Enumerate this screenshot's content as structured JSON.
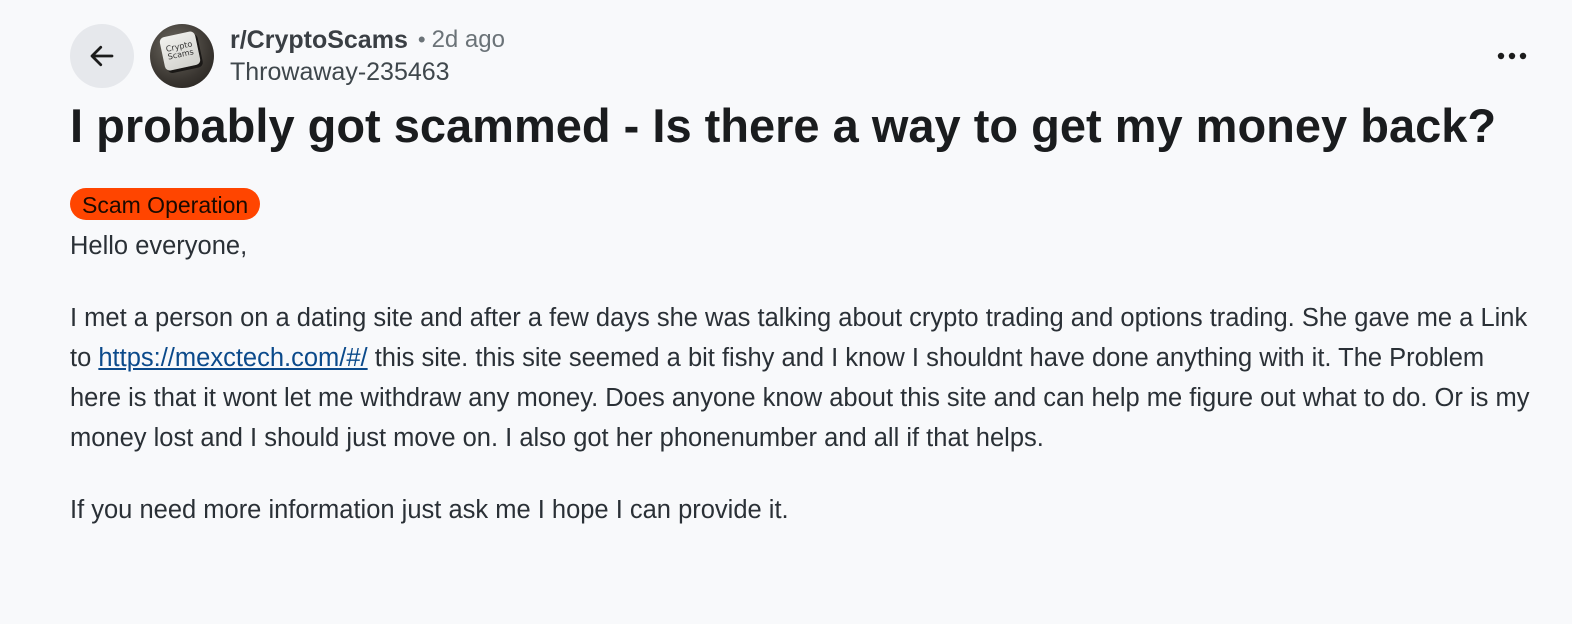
{
  "header": {
    "subreddit": "r/CryptoScams",
    "separator": "•",
    "age": "2d ago",
    "author": "Throwaway-235463",
    "avatar_text_line1": "Crypto",
    "avatar_text_line2": "Scams"
  },
  "post": {
    "title": "I probably got scammed - Is there a way to get my money back?",
    "flair": "Scam Operation",
    "greeting": "Hello everyone,",
    "paragraph1_before_link": "I met a person on a dating site and after a few days she was talking about crypto trading and options trading. She gave me a Link to ",
    "link_text": "https://mexctech.com/#/",
    "paragraph1_after_link": " this site. this site seemed a bit fishy and I know I shouldnt have done anything with it. The Problem here is that it wont let me withdraw any money. Does anyone know about this site and can help me figure out what to do. Or is my money lost and I should just move on. I also got her phonenumber and all if that helps.",
    "paragraph2": "If you need more information just ask me I hope I can provide it."
  },
  "icons": {
    "back": "arrow-left-icon",
    "more": "more-horizontal-icon"
  },
  "colors": {
    "flair_bg": "#ff4500",
    "link": "#0b4a8b",
    "page_bg": "#f8f9fb"
  }
}
